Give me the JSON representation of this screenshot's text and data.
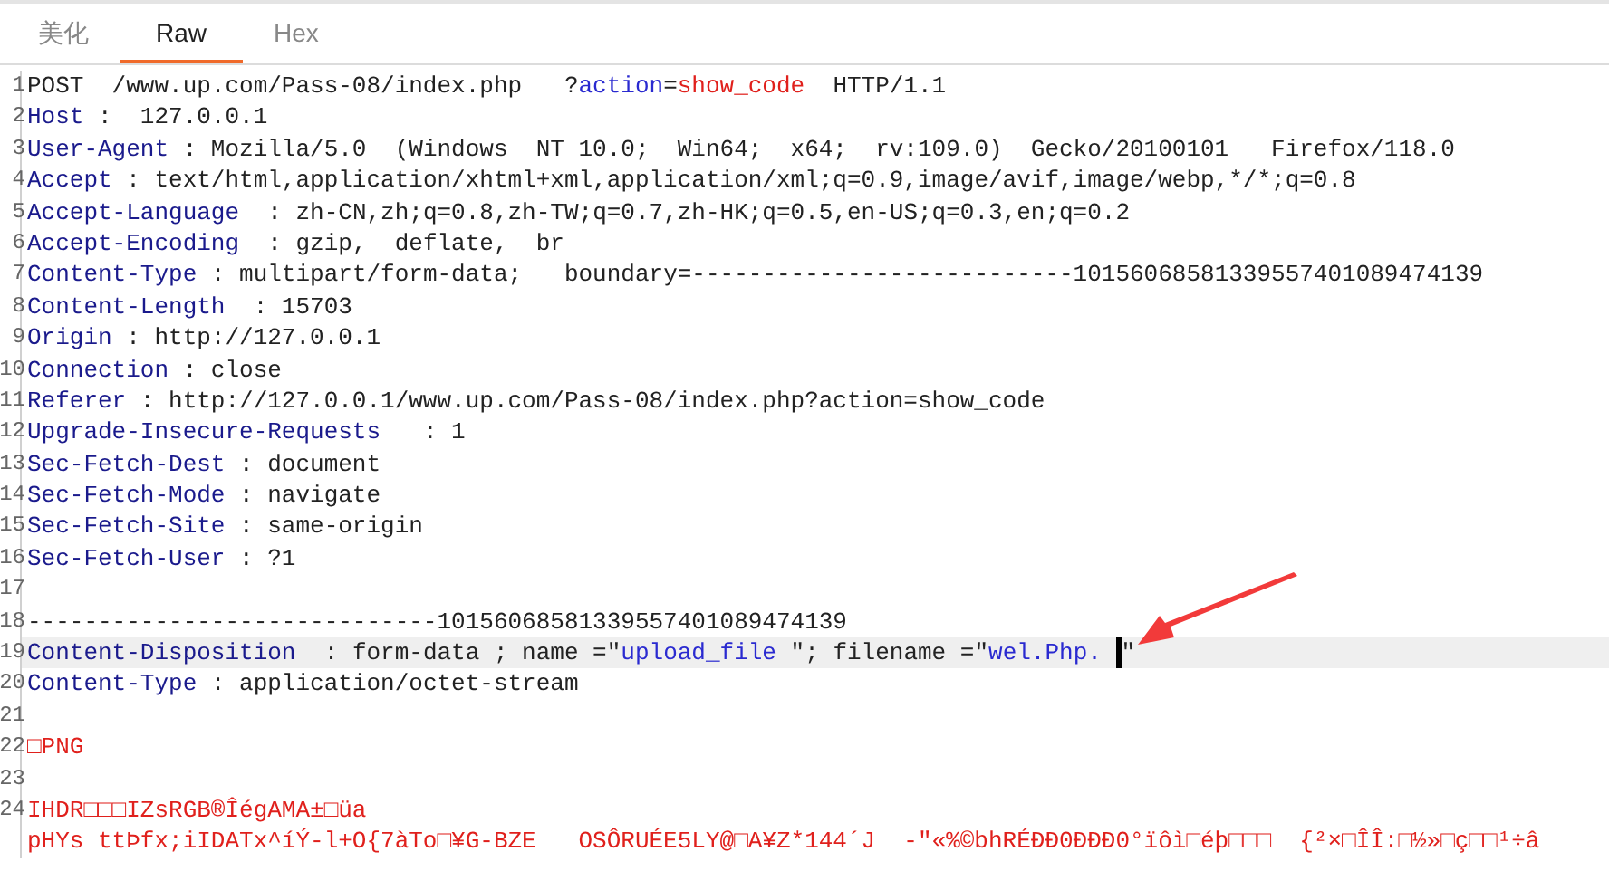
{
  "tabs": [
    {
      "label": "美化",
      "selected": false
    },
    {
      "label": "Raw",
      "selected": true
    },
    {
      "label": "Hex",
      "selected": false
    }
  ],
  "lines": [
    {
      "number": "1",
      "selected": false,
      "segments": [
        {
          "kind": "plain",
          "text": "POST  /www.up.com/Pass-08/index.php   ?"
        },
        {
          "kind": "param",
          "text": "action"
        },
        {
          "kind": "plain",
          "text": "="
        },
        {
          "kind": "value",
          "text": "show_code"
        },
        {
          "kind": "plain",
          "text": "  HTTP/1.1"
        }
      ]
    },
    {
      "number": "2",
      "selected": false,
      "segments": [
        {
          "kind": "key",
          "text": "Host"
        },
        {
          "kind": "plain",
          "text": " :  127.0.0.1"
        }
      ]
    },
    {
      "number": "3",
      "selected": false,
      "segments": [
        {
          "kind": "key",
          "text": "User-Agent"
        },
        {
          "kind": "plain",
          "text": " : Mozilla/5.0  (Windows  NT 10.0;  Win64;  x64;  rv:109.0)  Gecko/20100101   Firefox/118.0"
        }
      ]
    },
    {
      "number": "4",
      "selected": false,
      "segments": [
        {
          "kind": "key",
          "text": "Accept"
        },
        {
          "kind": "plain",
          "text": " : text/html,application/xhtml+xml,application/xml;q=0.9,image/avif,image/webp,*/*;q=0.8"
        }
      ]
    },
    {
      "number": "5",
      "selected": false,
      "segments": [
        {
          "kind": "key",
          "text": "Accept-Language"
        },
        {
          "kind": "plain",
          "text": "  : zh-CN,zh;q=0.8,zh-TW;q=0.7,zh-HK;q=0.5,en-US;q=0.3,en;q=0.2"
        }
      ]
    },
    {
      "number": "6",
      "selected": false,
      "segments": [
        {
          "kind": "key",
          "text": "Accept-Encoding"
        },
        {
          "kind": "plain",
          "text": "  : gzip,  deflate,  br"
        }
      ]
    },
    {
      "number": "7",
      "selected": false,
      "segments": [
        {
          "kind": "key",
          "text": "Content-Type"
        },
        {
          "kind": "plain",
          "text": " : multipart/form-data;   boundary=---------------------------10156068581339557401089474139"
        }
      ]
    },
    {
      "number": "8",
      "selected": false,
      "segments": [
        {
          "kind": "key",
          "text": "Content-Length"
        },
        {
          "kind": "plain",
          "text": "  : 15703"
        }
      ]
    },
    {
      "number": "9",
      "selected": false,
      "segments": [
        {
          "kind": "key",
          "text": "Origin"
        },
        {
          "kind": "plain",
          "text": " : http://127.0.0.1"
        }
      ]
    },
    {
      "number": "10",
      "selected": false,
      "segments": [
        {
          "kind": "key",
          "text": "Connection"
        },
        {
          "kind": "plain",
          "text": " : close"
        }
      ]
    },
    {
      "number": "11",
      "selected": false,
      "segments": [
        {
          "kind": "key",
          "text": "Referer"
        },
        {
          "kind": "plain",
          "text": " : http://127.0.0.1/www.up.com/Pass-08/index.php?action=show_code"
        }
      ]
    },
    {
      "number": "12",
      "selected": false,
      "segments": [
        {
          "kind": "key",
          "text": "Upgrade-Insecure-Requests"
        },
        {
          "kind": "plain",
          "text": "   : 1"
        }
      ]
    },
    {
      "number": "13",
      "selected": false,
      "segments": [
        {
          "kind": "key",
          "text": "Sec-Fetch-Dest"
        },
        {
          "kind": "plain",
          "text": " : document"
        }
      ]
    },
    {
      "number": "14",
      "selected": false,
      "segments": [
        {
          "kind": "key",
          "text": "Sec-Fetch-Mode"
        },
        {
          "kind": "plain",
          "text": " : navigate"
        }
      ]
    },
    {
      "number": "15",
      "selected": false,
      "segments": [
        {
          "kind": "key",
          "text": "Sec-Fetch-Site"
        },
        {
          "kind": "plain",
          "text": " : same-origin"
        }
      ]
    },
    {
      "number": "16",
      "selected": false,
      "segments": [
        {
          "kind": "key",
          "text": "Sec-Fetch-User"
        },
        {
          "kind": "plain",
          "text": " : ?1"
        }
      ]
    },
    {
      "number": "17",
      "selected": false
    },
    {
      "number": "18",
      "selected": false,
      "segments": [
        {
          "kind": "plain",
          "text": "-----------------------------10156068581339557401089474139"
        }
      ]
    },
    {
      "number": "19",
      "selected": true,
      "segments": [
        {
          "kind": "key",
          "text": "Content-Disposition"
        },
        {
          "kind": "plain",
          "text": "  : form-data ; name =\""
        },
        {
          "kind": "param",
          "text": "upload_file "
        },
        {
          "kind": "plain",
          "text": "\"; filename =\""
        },
        {
          "kind": "param",
          "text": "wel.Php. "
        },
        {
          "kind": "caret"
        },
        {
          "kind": "plain",
          "text": "\""
        }
      ]
    },
    {
      "number": "20",
      "selected": false,
      "segments": [
        {
          "kind": "key",
          "text": "Content-Type"
        },
        {
          "kind": "plain",
          "text": " : application/octet-stream"
        }
      ]
    },
    {
      "number": "21",
      "selected": false
    },
    {
      "number": "22",
      "selected": false,
      "segments": [
        {
          "kind": "value",
          "text": "□PNG"
        }
      ]
    },
    {
      "number": "23",
      "selected": false
    },
    {
      "number": "24",
      "selected": false,
      "segments": [
        {
          "kind": "value",
          "text": "IHDR□□□IZsRGB®ÎégAMA±□üa"
        }
      ]
    },
    {
      "selected": false,
      "segments": [
        {
          "kind": "value",
          "text": "pHYs ttÞfx;iIDATx^íÝ-l+O{7àTo□¥G-BZE   OSÔRUÉE5LY@□A¥Z*144´J  -\"«%©bhRÉÐÐ0ÐÐÐ0°ïôì□éþ□□□  {²×□ÎÎ:□½»□ç□□¹÷â"
        }
      ]
    }
  ]
}
